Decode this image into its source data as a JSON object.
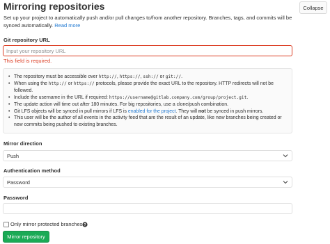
{
  "header": {
    "title": "Mirroring repositories",
    "collapse_label": "Collapse",
    "description": "Set up your project to automatically push and/or pull changes to/from another repository. Branches, tags, and commits will be synced automatically.",
    "read_more": "Read more"
  },
  "git_url": {
    "label": "Git repository URL",
    "placeholder": "Input your repository URL",
    "error": "This field is required."
  },
  "info": {
    "item1_a": "The repository must be accessible over ",
    "item1_code1": "http://",
    "item1_b": ", ",
    "item1_code2": "https://",
    "item1_c": ", ",
    "item1_code3": "ssh://",
    "item1_d": " or ",
    "item1_code4": "git://",
    "item1_e": ".",
    "item2_a": "When using the ",
    "item2_code1": "http://",
    "item2_b": " or ",
    "item2_code2": "https://",
    "item2_c": " protocols, please provide the exact URL to the repository. HTTP redirects will not be followed.",
    "item3_a": "Include the username in the URL if required: ",
    "item3_code": "https://username@gitlab.company.com/group/project.git",
    "item3_b": ".",
    "item4": "The update action will time out after 180 minutes. For big repositories, use a clone/push combination.",
    "item5_a": "Git LFS objects will be synced in pull mirrors if LFS is ",
    "item5_link": "enabled for the project",
    "item5_b": ". They will ",
    "item5_bold": "not",
    "item5_c": " be synced in push mirrors.",
    "item6": "This user will be the author of all events in the activity feed that are the result of an update, like new branches being created or new commits being pushed to existing branches."
  },
  "direction": {
    "label": "Mirror direction",
    "value": "Push"
  },
  "auth": {
    "label": "Authentication method",
    "value": "Password"
  },
  "password": {
    "label": "Password",
    "value": ""
  },
  "protected": {
    "label": "Only mirror protected branches",
    "checked": false
  },
  "submit_label": "Mirror repository",
  "colors": {
    "primary_link": "#1f78d1",
    "error": "#db3b21",
    "success_button": "#1aaa55"
  },
  "icons": {
    "select_arrow": "chevron-down-icon",
    "help": "question-circle-icon"
  }
}
